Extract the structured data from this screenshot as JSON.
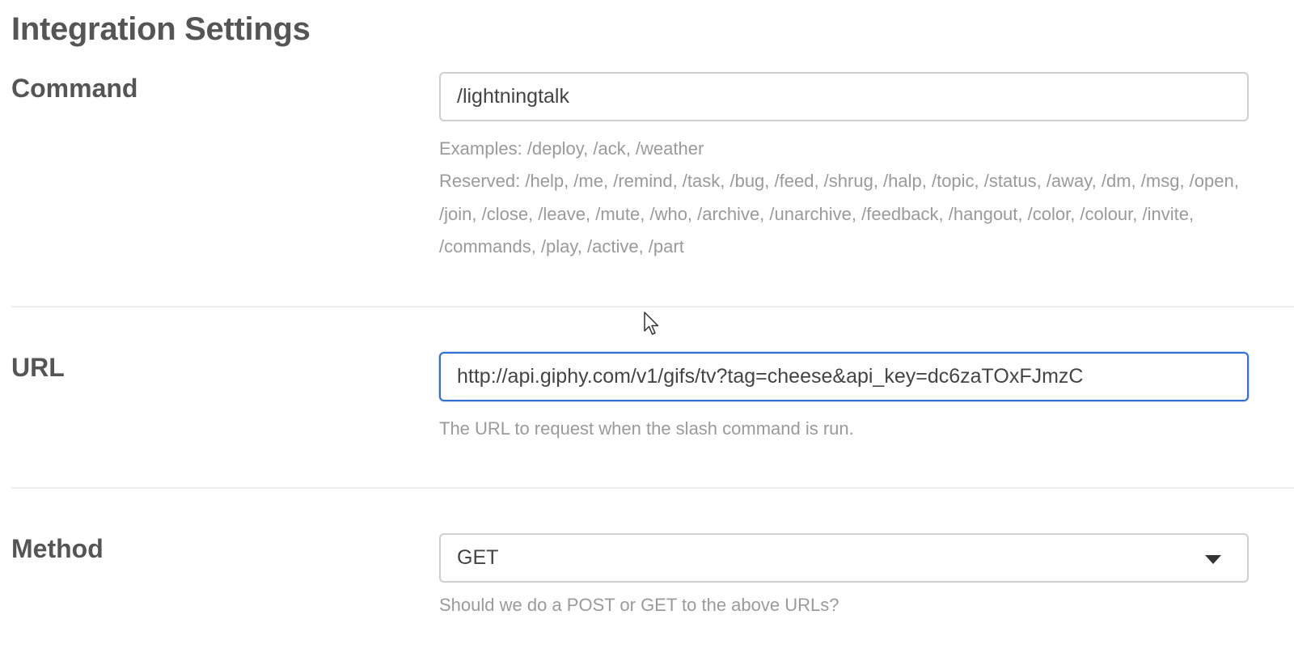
{
  "page": {
    "title": "Integration Settings"
  },
  "command": {
    "label": "Command",
    "value": "/lightningtalk",
    "examples": "Examples: /deploy, /ack, /weather",
    "reserved": "Reserved: /help, /me, /remind, /task, /bug, /feed, /shrug, /halp, /topic, /status, /away, /dm, /msg, /open, /join, /close, /leave, /mute, /who, /archive, /unarchive, /feedback, /hangout, /color, /colour, /invite, /commands, /play, /active, /part"
  },
  "url": {
    "label": "URL",
    "value": "http://api.giphy.com/v1/gifs/tv?tag=cheese&api_key=dc6zaTOxFJmzC",
    "help": "The URL to request when the slash command is run."
  },
  "method": {
    "label": "Method",
    "selected": "GET",
    "help": "Should we do a POST or GET to the above URLs?"
  },
  "colors": {
    "focus_border": "#2f6fd6",
    "help_text": "#9a9a9a",
    "label_text": "#555555"
  },
  "icons": {
    "select_caret": "caret-down-icon",
    "pointer": "mouse-cursor-icon"
  }
}
